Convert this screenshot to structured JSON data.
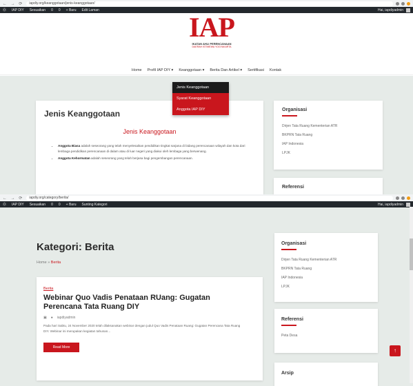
{
  "screen1": {
    "browser": {
      "url": "iapdiy.org/keanggotaan/jenis-keanggotaan/",
      "nav_icons": "← → ⟳"
    },
    "adminbar": {
      "left_items": [
        "IAP DIY",
        "Sesuaikan",
        "0",
        "0",
        "+ Baru",
        "Edit Laman"
      ],
      "right_text": "Hai, iapdiyadmin"
    },
    "logo": {
      "text": "IAP",
      "subtitle": "IKATAN AHLI PERENCANAAN",
      "subtitle2": "DAERAH ISTIMEWA YOGYAKARTA"
    },
    "menu": [
      "Home",
      "Profil IAP DIY ▾",
      "Keanggotaan ▾",
      "Berita Dan Artikel ▾",
      "Sertifikasi",
      "Kontak"
    ],
    "dropdown": [
      "Jenis Keanggotaan",
      "Syarat Keanggotaan",
      "Anggota IAP DIY"
    ],
    "page": {
      "heading": "Jenis Keanggotaan",
      "subheading": "Jenis Keanggotaan",
      "items": [
        {
          "term": "Anggota Biasa",
          "text": " adalah seseorang yang telah menyelesaikan pendidikan tingkat sarjana di bidang perencanaan wilayah dan kota dari lembaga pendidikan perencanaan di dalam atau di luar negeri yang diakui oleh lembaga yang berwenang."
        },
        {
          "term": "Anggota Kehormatan",
          "text": " adalah seseorang yang telah berjasa bagi pengembangan perencanaan."
        }
      ]
    },
    "sidebar": {
      "org_title": "Organisasi",
      "org_links": [
        "Dirjen Tata Ruang Kementerian ATR",
        "BKPRN Tata Ruang",
        "IAP Indonesia",
        "LPJK"
      ],
      "ref_title": "Referensi"
    }
  },
  "screen2": {
    "browser": {
      "url": "iapdiy.org/category/berita/",
      "nav_icons": "← → ⟳"
    },
    "adminbar": {
      "left_items": [
        "IAP DIY",
        "Sesuaikan",
        "0",
        "0",
        "+ Baru",
        "Sunting Kategori"
      ],
      "right_text": "Hai, iapdiyadmin"
    },
    "title": "Kategori: Berita",
    "breadcrumb": {
      "home": "Home",
      "sep": " » ",
      "current": "Berita"
    },
    "post": {
      "category": "Berita",
      "title": "Webinar Quo Vadis Penataan RUang: Gugatan Perencana Tata Ruang DIY",
      "author": "iapdiyadmin",
      "excerpt": "Pada hari Sabtu, 24 November 2020 telah dilaksanakan webinar dengan judul Quo Vadis Penataan Ruang: Gugatan Perencana Tata Ruang DIY. Webinar ini merupakan kegiatan tahunan...",
      "read_more": "Read More"
    },
    "sidebar": {
      "org_title": "Organisasi",
      "org_links": [
        "Dirjen Tata Ruang Kementerian ATR",
        "BKPRN Tata Ruang",
        "IAP Indonesia",
        "LPJK"
      ],
      "ref_title": "Referensi",
      "ref_links": [
        "Peta Desa"
      ],
      "arsip_title": "Arsip"
    },
    "to_top": "↑"
  },
  "colors": {
    "brand_red": "#c9161d",
    "admin_bar": "#23282d",
    "background": "#e6ebe8"
  }
}
